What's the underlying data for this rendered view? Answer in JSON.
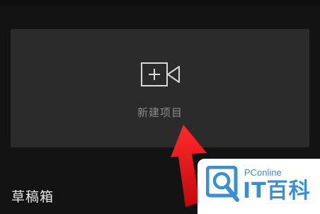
{
  "new_project": {
    "label": "新建项目",
    "icon": "video-add-icon"
  },
  "drafts": {
    "title": "草稿箱"
  },
  "annotation": {
    "arrow_color": "#e8141b"
  },
  "watermark": {
    "brand_small": "PConline",
    "brand_big": "IT百科",
    "color": "#3a8fd0"
  }
}
